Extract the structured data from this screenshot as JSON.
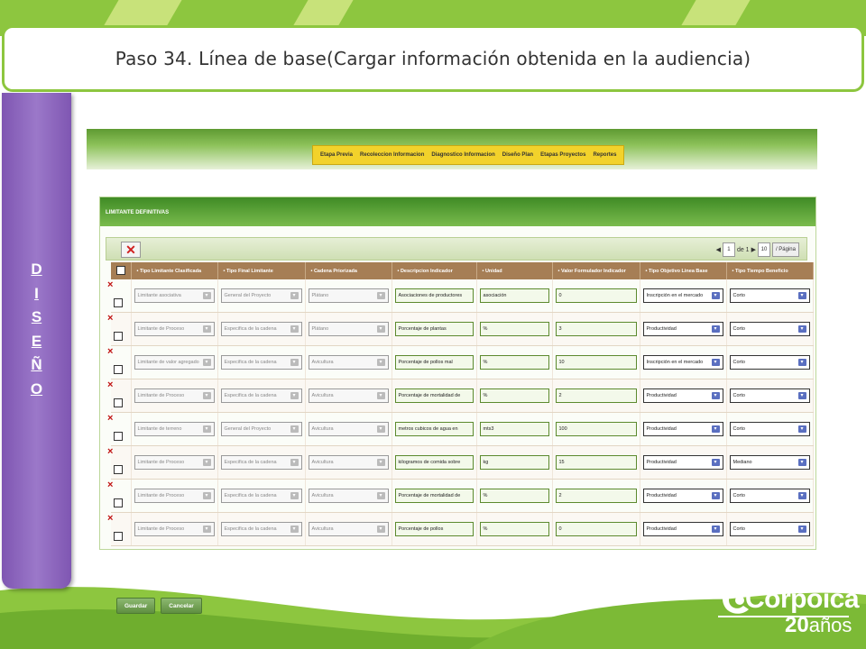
{
  "title": "Paso 34.  Línea de base(Cargar información obtenida en la audiencia)",
  "side_tab_letters": [
    "D",
    "I",
    "S",
    "E",
    "Ñ",
    "O"
  ],
  "colors": {
    "brand_green": "#8dc63f",
    "side_tab_purple": "#8a63bd",
    "menu_yellow": "#f2d22b",
    "header_brown": "#a67e55"
  },
  "app": {
    "menu": [
      "Etapa Previa",
      "Recoleccion Informacion",
      "Diagnostico Informacion",
      "Diseño Plan",
      "Etapas Proyectos",
      "Reportes"
    ],
    "panel_title": "LIMITANTE DEFINITIVAS",
    "pager": {
      "page": "1",
      "of_label": "de 1",
      "size": "10",
      "size_label": "/ Página"
    },
    "columns": [
      "Tipo Limitante Clasificada",
      "Tipo Final Limitante",
      "Cadena Priorizada",
      "Descripcion Indicador",
      "Unidad",
      "Valor Formulador Indicador",
      "Tipo Objetivo Linea Base",
      "Tipo Tiempo Beneficio"
    ],
    "rows": [
      [
        "Limitante asociativa",
        "General del Proyecto",
        "Plátano",
        "Asociaciones de productores",
        "asociación",
        "0",
        "Inscripción en el mercado",
        "Corto"
      ],
      [
        "Limitante de Proceso",
        "Especifica de la cadena",
        "Plátano",
        "Porcentaje de plantas",
        "%",
        "3",
        "Productividad",
        "Corto"
      ],
      [
        "Limitante de valor agregado",
        "Especifica de la cadena",
        "Avicultura",
        "Porcentaje de pollos mal",
        "%",
        "10",
        "Inscripción en el mercado",
        "Corto"
      ],
      [
        "Limitante de Proceso",
        "Especifica de la cadena",
        "Avicultura",
        "Porcentaje de mortalidad de",
        "%",
        "2",
        "Productividad",
        "Corto"
      ],
      [
        "Limitante de terreno",
        "General del Proyecto",
        "Avicultura",
        "metros cubicos de agua en",
        "mts3",
        "100",
        "Productividad",
        "Corto"
      ],
      [
        "Limitante de Proceso",
        "Especifica de la cadena",
        "Avicultura",
        "kilogramos de comida sobre",
        "kg",
        "15",
        "Productividad",
        "Mediano"
      ],
      [
        "Limitante de Proceso",
        "Especifica de la cadena",
        "Avicultura",
        "Porcentaje de mortalidad de",
        "%",
        "2",
        "Productividad",
        "Corto"
      ],
      [
        "Limitante de Proceso",
        "Especifica de la cadena",
        "Avicultura",
        "Porcentaje de pollos",
        "%",
        "0",
        "Productividad",
        "Corto"
      ]
    ],
    "save_label": "Guardar",
    "cancel_label": "Cancelar"
  },
  "logo": {
    "name": "Corpoica",
    "years_number": "20",
    "years_word": "años"
  }
}
